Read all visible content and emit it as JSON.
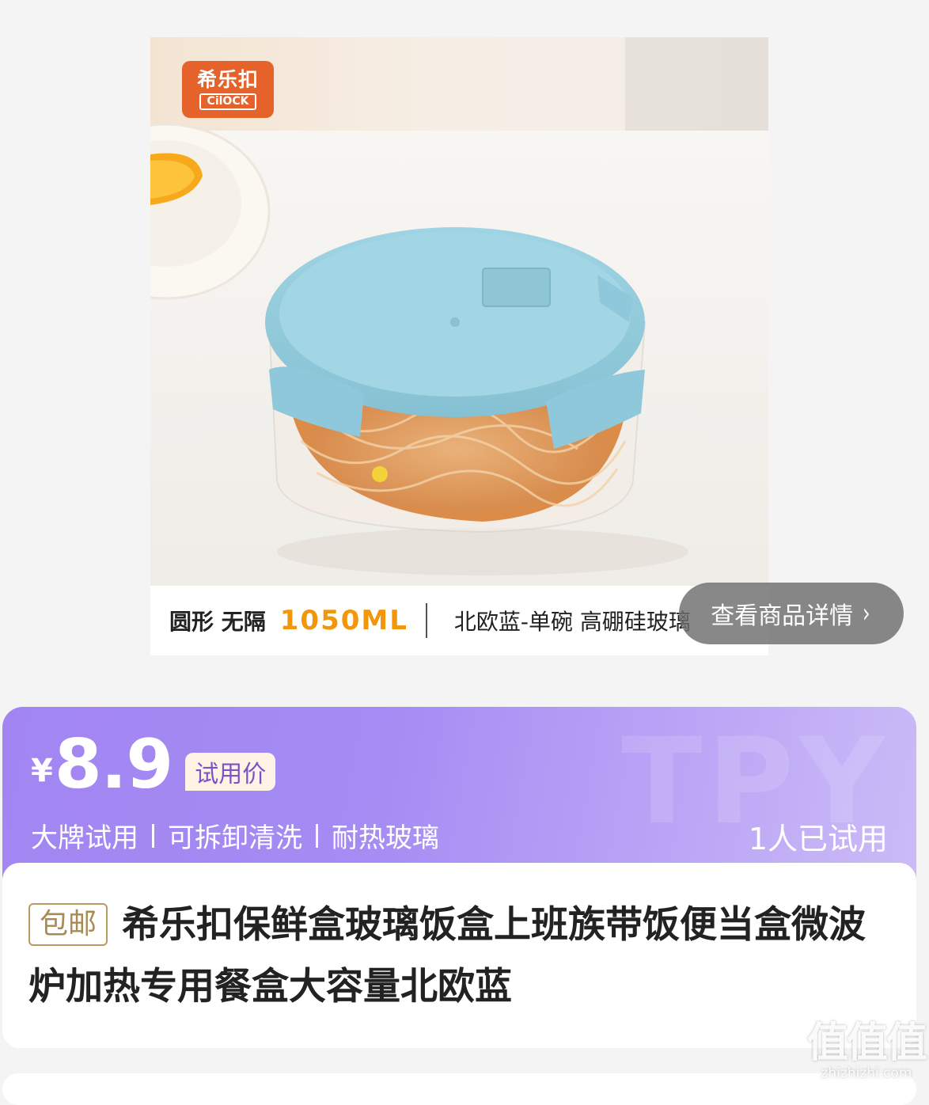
{
  "product_image": {
    "brand_logo": {
      "cn": "希乐扣",
      "en": "CilOCK"
    },
    "banner": {
      "shape": "圆形 无隔",
      "volume": "1050ML",
      "variant": "北欧蓝-单碗 高硼硅玻璃"
    }
  },
  "view_detail": {
    "label": "查看商品详情",
    "chevron": "›"
  },
  "price_card": {
    "currency": "¥",
    "price": "8.9",
    "price_tag": "试用价",
    "watermark": "TPY",
    "features": [
      "大牌试用",
      "可拆卸清洗",
      "耐热玻璃"
    ],
    "trial_count": "1人已试用"
  },
  "title_card": {
    "badge": "包邮",
    "title": "希乐扣保鲜盒玻璃饭盒上班族带饭便当盒微波炉加热专用餐盒大容量北欧蓝"
  },
  "site_watermark": {
    "big": "值值值",
    "small": "zhizhizhi.com"
  },
  "colors": {
    "accent_purple": "#a285f2",
    "volume_orange": "#f2960c",
    "lid_blue": "#8fcbdc",
    "badge_gold": "#b89a63"
  }
}
